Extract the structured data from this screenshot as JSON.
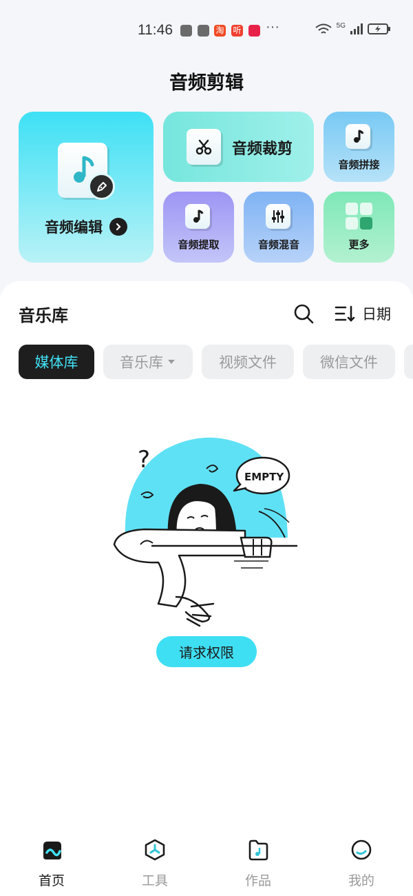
{
  "status_bar": {
    "time": "11:46",
    "network": "5G",
    "more": "···",
    "apps": [
      {
        "name": "huawei-app-icon",
        "color": "#6b6b6b"
      },
      {
        "name": "huawei-app-icon",
        "color": "#6b6b6b"
      },
      {
        "name": "taobao-icon",
        "text": "淘",
        "color": "#f04a23"
      },
      {
        "name": "ting-icon",
        "text": "听",
        "color": "#f0402f"
      },
      {
        "name": "tmall-icon",
        "color": "#e8234a"
      }
    ]
  },
  "header": {
    "title": "音频剪辑"
  },
  "tools": {
    "edit": "音频编辑",
    "cut": "音频裁剪",
    "join": "音频拼接",
    "extract": "音频提取",
    "mix": "音频混音",
    "more": "更多"
  },
  "library": {
    "title": "音乐库",
    "sort_label": "日期",
    "tabs": [
      {
        "label": "媒体库",
        "active": true
      },
      {
        "label": "音乐库",
        "active": false
      },
      {
        "label": "视频文件",
        "active": false
      },
      {
        "label": "微信文件",
        "active": false
      }
    ],
    "empty_text": "EMPTY",
    "permission_button": "请求权限"
  },
  "bottom_nav": [
    {
      "label": "首页",
      "icon": "home-icon",
      "active": true
    },
    {
      "label": "工具",
      "icon": "tools-icon",
      "active": false
    },
    {
      "label": "作品",
      "icon": "works-icon",
      "active": false
    },
    {
      "label": "我的",
      "icon": "profile-icon",
      "active": false
    }
  ],
  "colors": {
    "accent": "#3fdff3",
    "dark": "#1e1e1e",
    "inactive": "#9a9a9a"
  }
}
